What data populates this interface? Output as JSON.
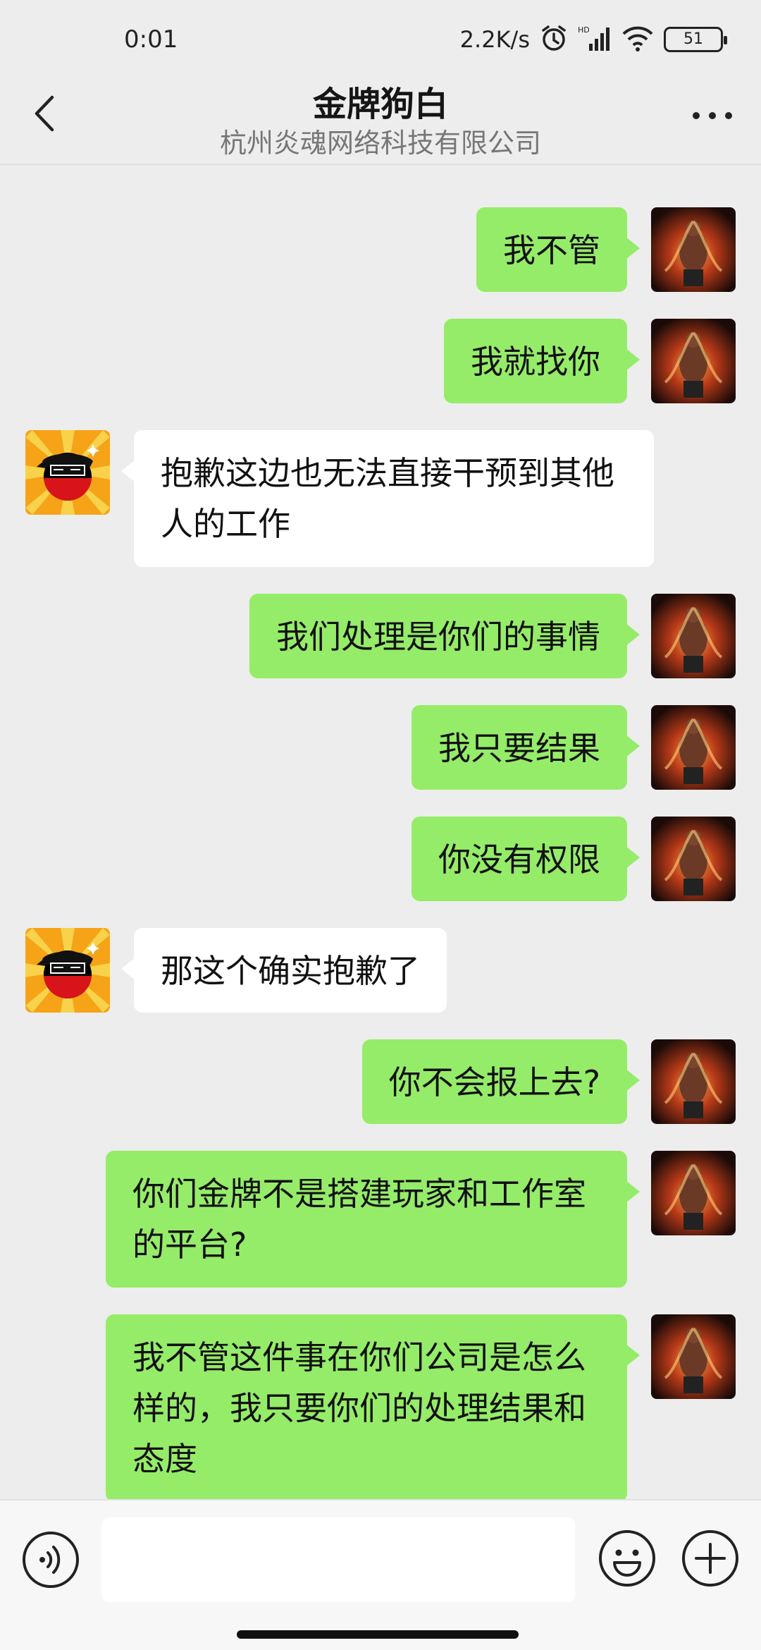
{
  "status_bar": {
    "time": "0:01",
    "net_speed": "2.2K/s",
    "hd_label": "HD",
    "battery": "51"
  },
  "header": {
    "title": "金牌狗白",
    "subtitle": "杭州炎魂网络科技有限公司"
  },
  "messages": [
    {
      "from": "me",
      "text": "我不管"
    },
    {
      "from": "me",
      "text": "我就找你"
    },
    {
      "from": "other",
      "text": "抱歉这边也无法直接干预到其他人的工作"
    },
    {
      "from": "me",
      "text": "我们处理是你们的事情"
    },
    {
      "from": "me",
      "text": "我只要结果"
    },
    {
      "from": "me",
      "text": "你没有权限"
    },
    {
      "from": "other",
      "text": "那这个确实抱歉了"
    },
    {
      "from": "me",
      "text": "你不会报上去?"
    },
    {
      "from": "me",
      "text": "你们金牌不是搭建玩家和工作室的平台?"
    },
    {
      "from": "me",
      "text": "我不管这件事在你们公司是怎么样的，我只要你们的处理结果和态度"
    }
  ],
  "input": {
    "value": "",
    "placeholder": ""
  },
  "colors": {
    "my_bubble": "#95ec69",
    "other_bubble": "#ffffff",
    "background": "#ededed"
  },
  "icons": {
    "back": "chevron-left-icon",
    "more": "more-dots-icon",
    "voice": "voice-icon",
    "emoji": "emoji-icon",
    "plus": "plus-icon"
  }
}
